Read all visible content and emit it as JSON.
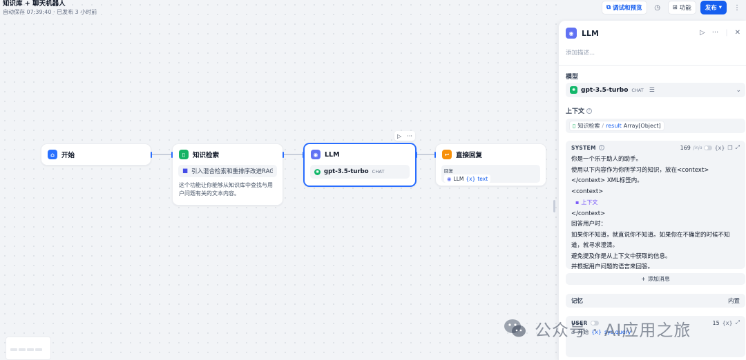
{
  "app": {
    "title": "知识库 + 聊天机器人",
    "autosave": "自动保存 07:39:40 · 已发布 3 小时前"
  },
  "toolbar": {
    "debug_label": "调试和预览",
    "features_label": "功能",
    "publish_label": "发布"
  },
  "nodes": {
    "start": {
      "title": "开始"
    },
    "knowledge": {
      "title": "知识检索",
      "dataset": "引入混合检索和重排序改进RAG...",
      "description": "这个功能让你能够从知识库中查找与用户问题有关的文本内容。"
    },
    "llm": {
      "title": "LLM",
      "model": "gpt-3.5-turbo",
      "model_tag": "CHAT"
    },
    "answer": {
      "title": "直接回复",
      "field_label": "回复",
      "ref_node": "LLM",
      "ref_var": "text"
    }
  },
  "panel": {
    "title": "LLM",
    "description_placeholder": "添加描述...",
    "model_label": "模型",
    "model_name": "gpt-3.5-turbo",
    "model_tag": "CHAT",
    "context_label": "上下文",
    "context_node": "知识检索",
    "context_var": "result",
    "context_type": "Array[Object]",
    "system": {
      "role": "SYSTEM",
      "count": "169",
      "jinja": "Jinja",
      "lines": [
        "你是一个乐于助人的助手。",
        "使用以下内容作为你所学习的知识，放在<context>",
        "</context> XML标签内。",
        "<context>"
      ],
      "context_var_label": "上下文",
      "lines_after": [
        "</context>",
        "回答用户时：",
        "如果你不知道，就直说你不知道。如果你在不确定的时候不知",
        "道，就寻求澄清。",
        "避免提及你是从上下文中获取的信息。",
        "并根据用户问题的语言来回答。"
      ]
    },
    "add_message_label": "添加消息",
    "memory_label": "记忆",
    "memory_value": "内置",
    "user": {
      "role": "USER",
      "count": "15",
      "start_node": "开始",
      "var": "sys.query"
    }
  },
  "watermark": "公众号 · AI应用之旅",
  "colors": {
    "primary": "#155eef",
    "start_icon": "#2970ff",
    "knowledge_icon": "#16b364",
    "llm_icon": "#6172f3",
    "answer_icon": "#f79009",
    "openai_green": "#12b76a",
    "context_purple": "#7a5af8"
  }
}
